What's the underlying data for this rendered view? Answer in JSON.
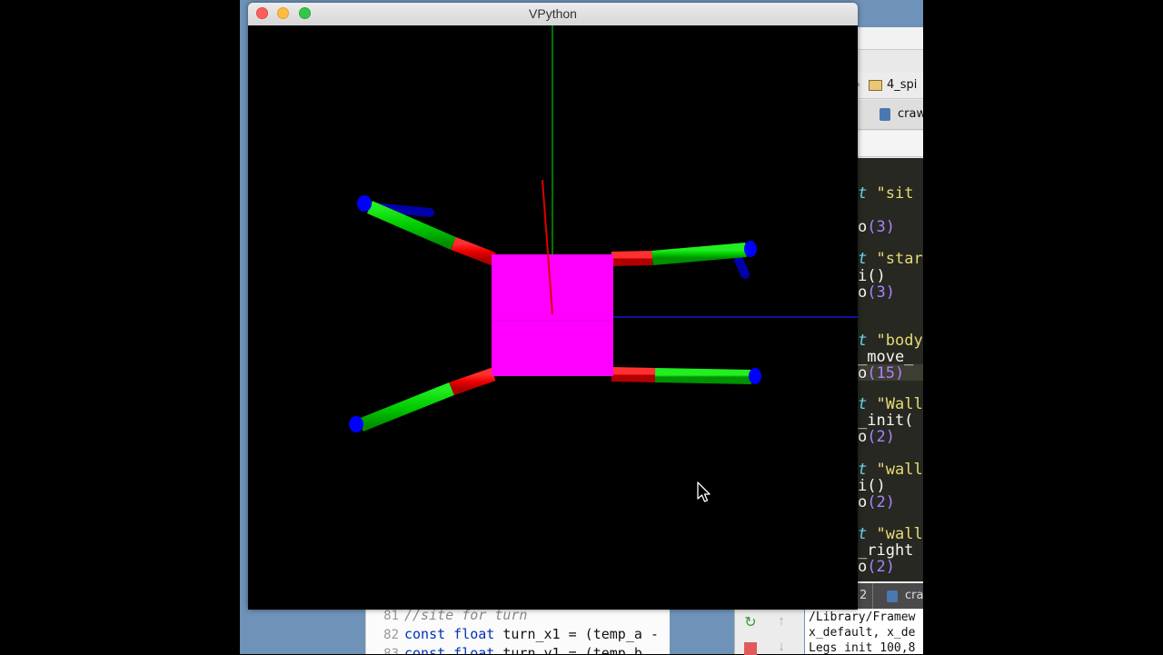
{
  "vpython_window": {
    "title": "VPython",
    "buttons": [
      "close",
      "minimize",
      "zoom"
    ]
  },
  "scene": {
    "background_color": "#000000",
    "body_color": "#ff00ff",
    "leg_upper_color": "#ff0000",
    "leg_lower_color": "#00cc00",
    "foot_color": "#0000ff",
    "axis_colors": {
      "y": "#00c000",
      "x": "#0000cc",
      "z": "#cc0000"
    },
    "legs": [
      "front-left",
      "front-right",
      "back-left",
      "back-right"
    ]
  },
  "ide": {
    "breadcrumb_folder": "4_spi",
    "tab_file": "craw",
    "editor_lines": [
      {
        "kw": "t",
        "rest": "\"sit",
        "type": "str"
      },
      {
        "kw": "",
        "rest": "(3)",
        "type": "num",
        "prefix": "o"
      },
      {
        "kw": "t",
        "rest": "\"star",
        "type": "str"
      },
      {
        "kw": "",
        "rest": "i()",
        "type": "plain"
      },
      {
        "kw": "",
        "rest": "(3)",
        "type": "num",
        "prefix": "o"
      },
      {
        "kw": "t",
        "rest": "\"body",
        "type": "str"
      },
      {
        "kw": "",
        "rest": "_move_",
        "type": "plain"
      },
      {
        "kw": "",
        "rest": "(15)",
        "type": "num",
        "prefix": "o"
      },
      {
        "kw": "t",
        "rest": "\"Wall",
        "type": "str"
      },
      {
        "kw": "",
        "rest": "_init(",
        "type": "plain"
      },
      {
        "kw": "",
        "rest": "(2)",
        "type": "num",
        "prefix": "o"
      },
      {
        "kw": "t",
        "rest": "\"wall",
        "type": "str"
      },
      {
        "kw": "",
        "rest": "i()",
        "type": "plain"
      },
      {
        "kw": "",
        "rest": "(2)",
        "type": "num",
        "prefix": "o"
      },
      {
        "kw": "t",
        "rest": "\"wall",
        "type": "str"
      },
      {
        "kw": "",
        "rest": "_right",
        "type": "plain"
      },
      {
        "kw": "",
        "rest": "(2)",
        "type": "num",
        "prefix": "o"
      },
      {
        "kw": "t",
        "rest": "\"wall",
        "type": "str"
      }
    ],
    "bottom_tab_num": "2",
    "bottom_tab_file": "cra"
  },
  "code_editor": {
    "lines": [
      {
        "num": "81",
        "text": "//site for turn",
        "kind": "comment"
      },
      {
        "num": "82",
        "kw": "const float",
        "text": " turn_x1 = (temp_a -",
        "kind": "code"
      },
      {
        "num": "83",
        "kw": "const float",
        "text": " turn_y1 = (temp_b",
        "kind": "code"
      }
    ]
  },
  "run_panel": {
    "rerun_icon": "↻",
    "up_icon": "↑",
    "down_icon": "↓"
  },
  "console": {
    "lines": [
      "/Library/Framew",
      "x_default, x_de",
      "Legs init 100,8"
    ]
  }
}
